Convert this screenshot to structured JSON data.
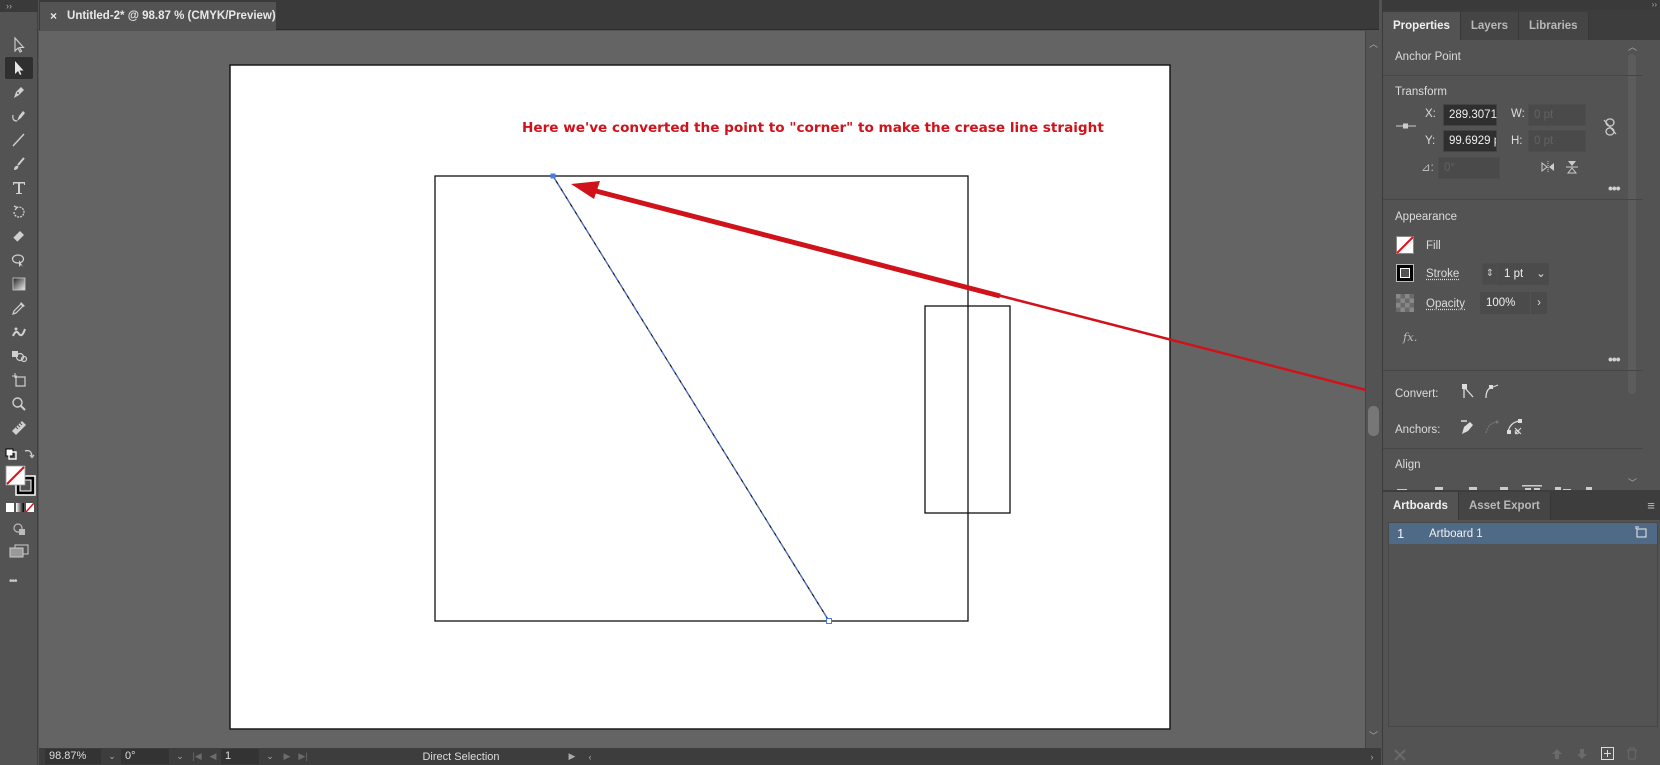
{
  "document": {
    "tab_title": "Untitled-2* @ 98.87 % (CMYK/Preview)",
    "close_glyph": "×"
  },
  "toolbar": {
    "collapse_glyph": "››",
    "tools": [
      {
        "name": "selection-tool",
        "active": false
      },
      {
        "name": "direct-selection-tool",
        "active": true
      },
      {
        "name": "pen-tool",
        "active": false
      },
      {
        "name": "curvature-tool",
        "active": false
      },
      {
        "name": "line-segment-tool",
        "active": false
      },
      {
        "name": "paintbrush-tool",
        "active": false
      },
      {
        "name": "type-tool",
        "active": false
      },
      {
        "name": "rotate-tool",
        "active": false
      },
      {
        "name": "eraser-tool",
        "active": false
      },
      {
        "name": "shape-builder-tool",
        "active": false
      },
      {
        "name": "gradient-tool",
        "active": false
      },
      {
        "name": "eyedropper-tool",
        "active": false
      },
      {
        "name": "puppet-warp-tool",
        "active": false
      },
      {
        "name": "symbol-sprayer-tool",
        "active": false
      },
      {
        "name": "artboard-tool",
        "active": false
      },
      {
        "name": "zoom-tool",
        "active": false
      },
      {
        "name": "measure-tool",
        "active": false
      }
    ],
    "more_glyph": "•••"
  },
  "canvas": {
    "annotation": "Here we've converted the point to \"corner\" to make the crease line straight",
    "annotation_color": "#d0121b",
    "selection_color": "#4a7be8"
  },
  "statusbar": {
    "zoom": "98.87%",
    "rotation": "0°",
    "artboard_number": "1",
    "tool_name": "Direct Selection"
  },
  "properties_panel": {
    "tabs": [
      "Properties",
      "Layers",
      "Libraries"
    ],
    "active_tab": "Properties",
    "selection_type": "Anchor Point",
    "transform": {
      "title": "Transform",
      "x_label": "X:",
      "x_value": "289.3071",
      "y_label": "Y:",
      "y_value": "99.6929 p",
      "w_label": "W:",
      "w_value": "0 pt",
      "h_label": "H:",
      "h_value": "0 pt",
      "angle_label": "⊿:",
      "angle_value": "0°"
    },
    "appearance": {
      "title": "Appearance",
      "fill_label": "Fill",
      "stroke_label": "Stroke",
      "stroke_value": "1 pt",
      "opacity_label": "Opacity",
      "opacity_value": "100%",
      "fx_label": "fx."
    },
    "convert_label": "Convert:",
    "anchors_label": "Anchors:",
    "align_title": "Align",
    "more_glyph": "•••"
  },
  "artboards_panel": {
    "tabs": [
      "Artboards",
      "Asset Export"
    ],
    "active_tab": "Artboards",
    "rows": [
      {
        "index": "1",
        "name": "Artboard 1",
        "selected": true
      }
    ]
  },
  "highlight_color": "#e4131b"
}
